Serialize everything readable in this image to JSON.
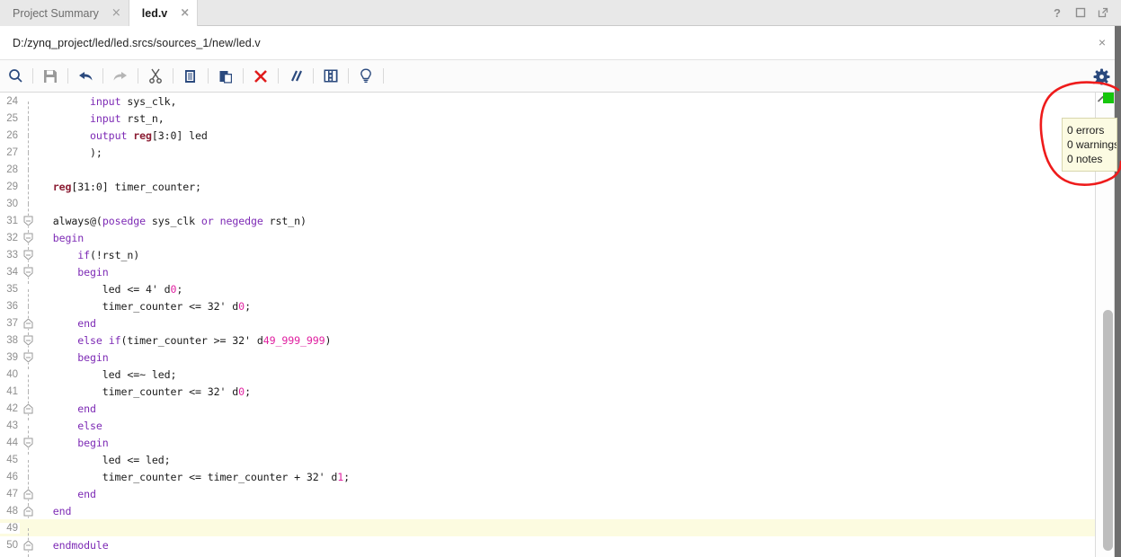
{
  "window": {
    "help_icon": "?",
    "restore_icon": "□",
    "float_icon": "⧉"
  },
  "tabs": [
    {
      "label": "Project Summary",
      "active": false,
      "close": "×"
    },
    {
      "label": "led.v",
      "active": true,
      "close": "×"
    }
  ],
  "path_bar": {
    "path": "D:/zynq_project/led/led.srcs/sources_1/new/led.v",
    "close": "×"
  },
  "toolbar": {
    "icons": [
      "search-icon",
      "save-icon",
      "undo-icon",
      "redo-icon",
      "cut-icon",
      "copy-icon",
      "paste-icon",
      "delete-icon",
      "comment-icon",
      "table-icon",
      "bulb-icon"
    ],
    "gear": "gear-icon"
  },
  "overview": {
    "status_color": "#16c60c",
    "chevron": "▲"
  },
  "tooltip": {
    "errors": "0 errors",
    "warnings": "0 warnings",
    "notes": "0 notes"
  },
  "annotation": {
    "color": "#ee1b1b",
    "shape": "hand-drawn-ellipse"
  },
  "editor": {
    "highlight_line": 49,
    "highlight_color": "#fcfbe0",
    "syntax_colors": {
      "keyword": "#7d2ab5",
      "type": "#8b1d33",
      "number": "#e020a0",
      "plain": "#1a1a1a"
    },
    "lines": [
      {
        "n": 24,
        "fold": "dash",
        "tokens": [
          {
            "t": "        ",
            "c": "pl"
          },
          {
            "t": "input",
            "c": "kw"
          },
          {
            "t": " sys_clk,",
            "c": "pl"
          }
        ]
      },
      {
        "n": 25,
        "fold": "dash",
        "tokens": [
          {
            "t": "        ",
            "c": "pl"
          },
          {
            "t": "input",
            "c": "kw"
          },
          {
            "t": " rst_n,",
            "c": "pl"
          }
        ]
      },
      {
        "n": 26,
        "fold": "dash",
        "tokens": [
          {
            "t": "        ",
            "c": "pl"
          },
          {
            "t": "output ",
            "c": "kw"
          },
          {
            "t": "reg",
            "c": "type"
          },
          {
            "t": "[3:0] led",
            "c": "pl"
          }
        ]
      },
      {
        "n": 27,
        "fold": "dash",
        "tokens": [
          {
            "t": "        );",
            "c": "pl"
          }
        ]
      },
      {
        "n": 28,
        "fold": "dash",
        "tokens": [
          {
            "t": "",
            "c": "pl"
          }
        ]
      },
      {
        "n": 29,
        "fold": "dash",
        "tokens": [
          {
            "t": "  ",
            "c": "pl"
          },
          {
            "t": "reg",
            "c": "type"
          },
          {
            "t": "[31:0] timer_counter;",
            "c": "pl"
          }
        ]
      },
      {
        "n": 30,
        "fold": "dash",
        "tokens": [
          {
            "t": "",
            "c": "pl"
          }
        ]
      },
      {
        "n": 31,
        "fold": "open",
        "tokens": [
          {
            "t": "  always@(",
            "c": "pl"
          },
          {
            "t": "posedge",
            "c": "kw"
          },
          {
            "t": " sys_clk ",
            "c": "pl"
          },
          {
            "t": "or",
            "c": "kw"
          },
          {
            "t": " ",
            "c": "pl"
          },
          {
            "t": "negedge",
            "c": "kw"
          },
          {
            "t": " rst_n)",
            "c": "pl"
          }
        ]
      },
      {
        "n": 32,
        "fold": "open",
        "tokens": [
          {
            "t": "  ",
            "c": "pl"
          },
          {
            "t": "begin",
            "c": "kw"
          }
        ]
      },
      {
        "n": 33,
        "fold": "open",
        "tokens": [
          {
            "t": "      ",
            "c": "pl"
          },
          {
            "t": "if",
            "c": "kw"
          },
          {
            "t": "(!rst_n)",
            "c": "pl"
          }
        ]
      },
      {
        "n": 34,
        "fold": "open",
        "tokens": [
          {
            "t": "      ",
            "c": "pl"
          },
          {
            "t": "begin",
            "c": "kw"
          }
        ]
      },
      {
        "n": 35,
        "fold": "dash",
        "tokens": [
          {
            "t": "          led <= 4'",
            "c": "pl"
          },
          {
            "t": " d",
            "c": "pl"
          },
          {
            "t": "0",
            "c": "num"
          },
          {
            "t": ";",
            "c": "pl"
          }
        ]
      },
      {
        "n": 36,
        "fold": "dash",
        "tokens": [
          {
            "t": "          timer_counter <= 32'",
            "c": "pl"
          },
          {
            "t": " d",
            "c": "pl"
          },
          {
            "t": "0",
            "c": "num"
          },
          {
            "t": ";",
            "c": "pl"
          }
        ]
      },
      {
        "n": 37,
        "fold": "close",
        "tokens": [
          {
            "t": "      ",
            "c": "pl"
          },
          {
            "t": "end",
            "c": "kw"
          }
        ]
      },
      {
        "n": 38,
        "fold": "open",
        "tokens": [
          {
            "t": "      ",
            "c": "pl"
          },
          {
            "t": "else ",
            "c": "kw"
          },
          {
            "t": "if",
            "c": "kw"
          },
          {
            "t": "(timer_counter >= 32'",
            "c": "pl"
          },
          {
            "t": " d",
            "c": "pl"
          },
          {
            "t": "49_999_999",
            "c": "num"
          },
          {
            "t": ")",
            "c": "pl"
          }
        ]
      },
      {
        "n": 39,
        "fold": "open",
        "tokens": [
          {
            "t": "      ",
            "c": "pl"
          },
          {
            "t": "begin",
            "c": "kw"
          }
        ]
      },
      {
        "n": 40,
        "fold": "dash",
        "tokens": [
          {
            "t": "          led <=~ led;",
            "c": "pl"
          }
        ]
      },
      {
        "n": 41,
        "fold": "dash",
        "tokens": [
          {
            "t": "          timer_counter <= 32'",
            "c": "pl"
          },
          {
            "t": " d",
            "c": "pl"
          },
          {
            "t": "0",
            "c": "num"
          },
          {
            "t": ";",
            "c": "pl"
          }
        ]
      },
      {
        "n": 42,
        "fold": "close",
        "tokens": [
          {
            "t": "      ",
            "c": "pl"
          },
          {
            "t": "end",
            "c": "kw"
          }
        ]
      },
      {
        "n": 43,
        "fold": "dash",
        "tokens": [
          {
            "t": "      ",
            "c": "pl"
          },
          {
            "t": "else",
            "c": "kw"
          }
        ]
      },
      {
        "n": 44,
        "fold": "open",
        "tokens": [
          {
            "t": "      ",
            "c": "pl"
          },
          {
            "t": "begin",
            "c": "kw"
          }
        ]
      },
      {
        "n": 45,
        "fold": "dash",
        "tokens": [
          {
            "t": "          led <= led;",
            "c": "pl"
          }
        ]
      },
      {
        "n": 46,
        "fold": "dash",
        "tokens": [
          {
            "t": "          timer_counter <= timer_counter + 32'",
            "c": "pl"
          },
          {
            "t": " d",
            "c": "pl"
          },
          {
            "t": "1",
            "c": "num"
          },
          {
            "t": ";",
            "c": "pl"
          }
        ]
      },
      {
        "n": 47,
        "fold": "close",
        "tokens": [
          {
            "t": "      ",
            "c": "pl"
          },
          {
            "t": "end",
            "c": "kw"
          }
        ]
      },
      {
        "n": 48,
        "fold": "close",
        "tokens": [
          {
            "t": "  ",
            "c": "pl"
          },
          {
            "t": "end",
            "c": "kw"
          }
        ]
      },
      {
        "n": 49,
        "fold": "dash",
        "tokens": [
          {
            "t": "",
            "c": "pl"
          }
        ]
      },
      {
        "n": 50,
        "fold": "close",
        "tokens": [
          {
            "t": "  ",
            "c": "pl"
          },
          {
            "t": "endmodule",
            "c": "kw"
          }
        ]
      }
    ]
  }
}
